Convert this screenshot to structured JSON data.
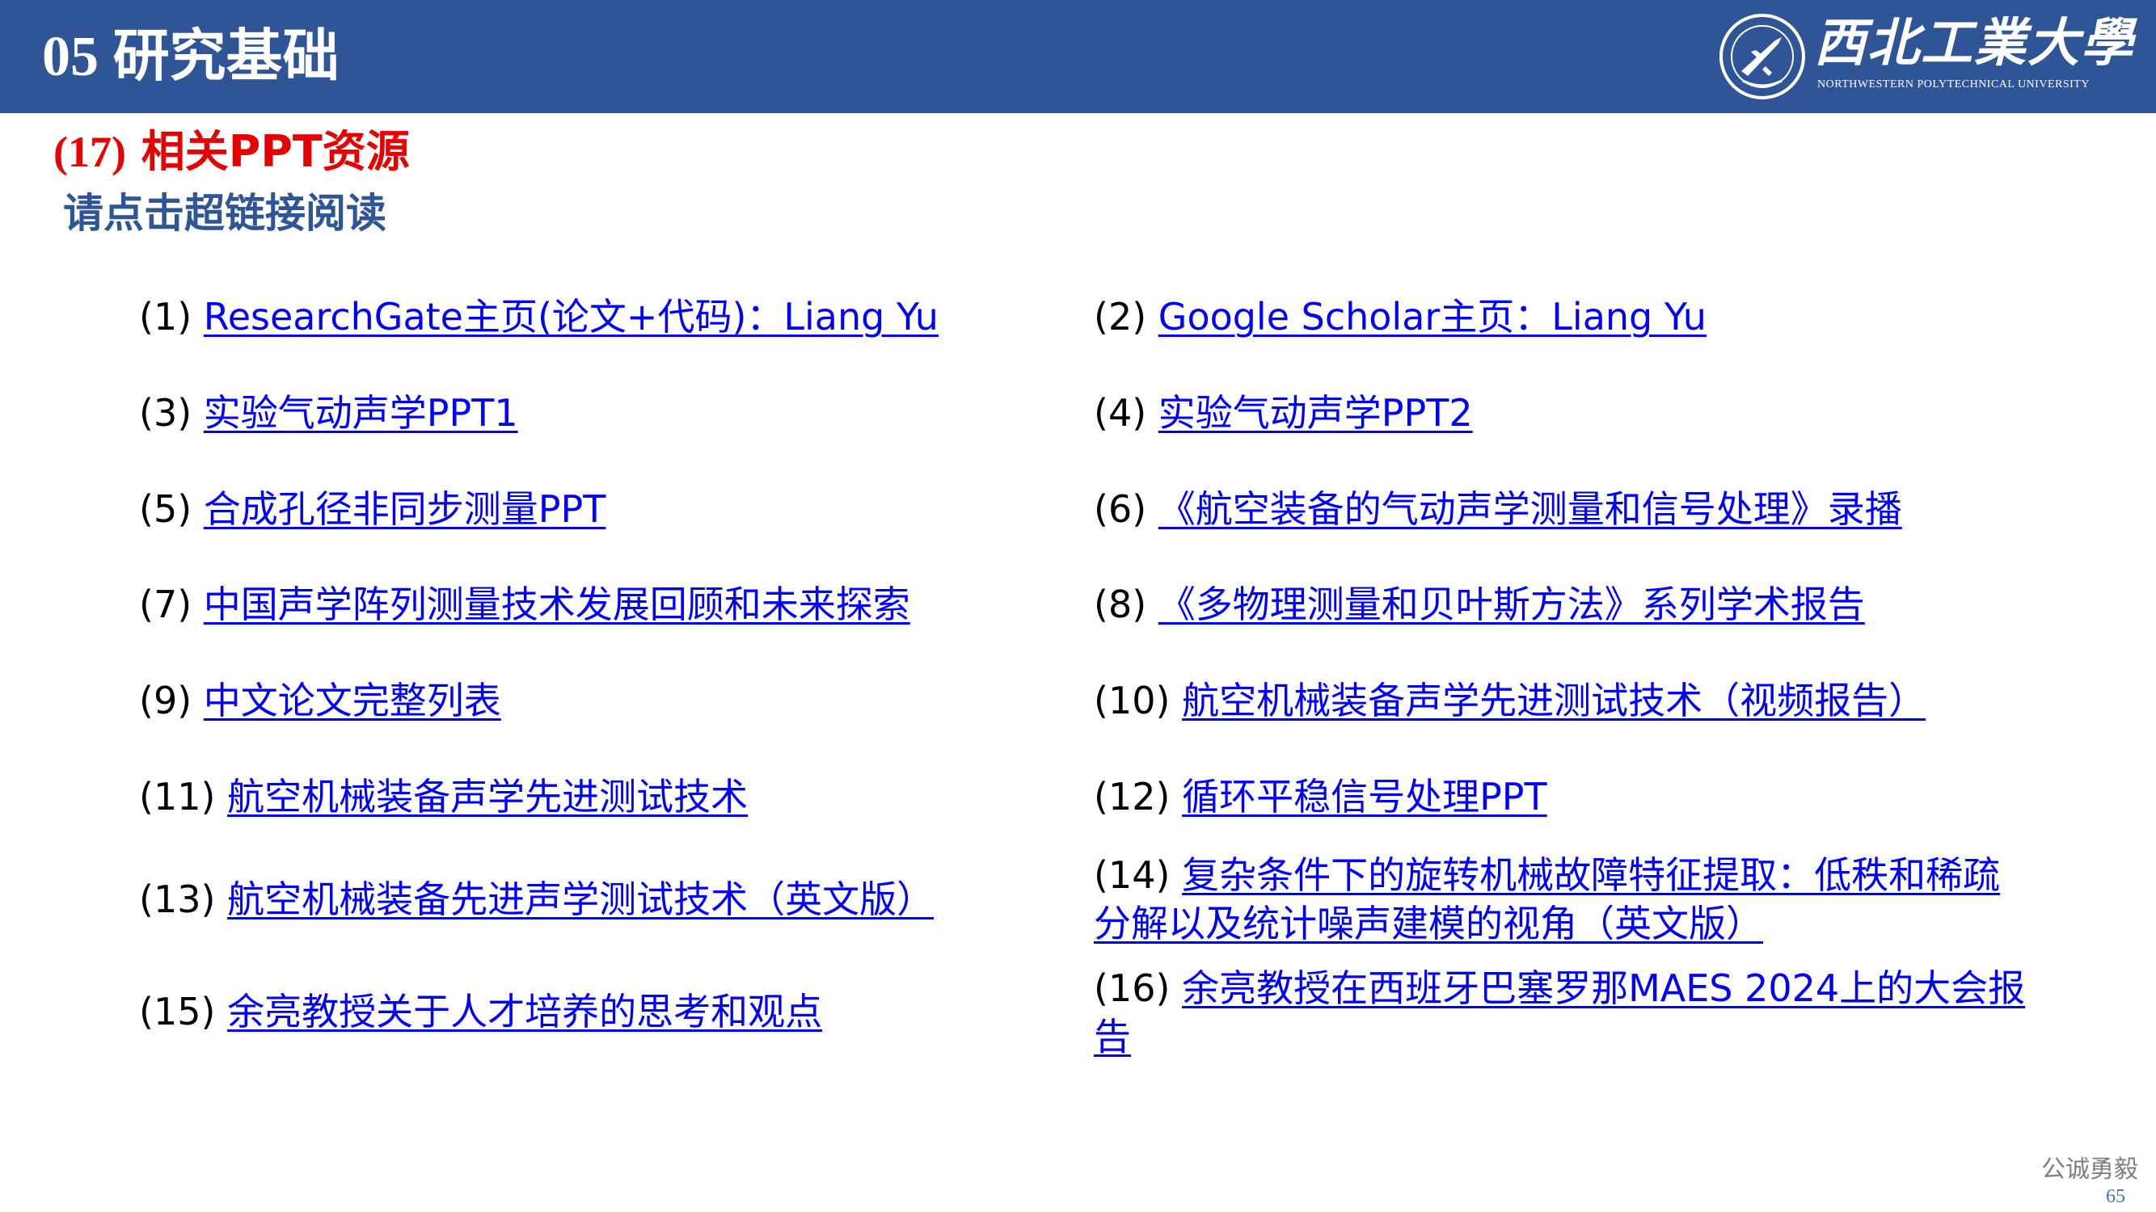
{
  "header": {
    "title": "05 研究基础",
    "logo_name": "西北工業大學",
    "logo_en": "NORTHWESTERN POLYTECHNICAL UNIVERSITY"
  },
  "section": {
    "number": "(17)",
    "title": "相关PPT资源",
    "instruction": "请点击超链接阅读"
  },
  "links": [
    {
      "num": "(1)",
      "text": "ResearchGate主页(论文+代码)：Liang Yu"
    },
    {
      "num": "(2)",
      "text": "Google Scholar主页：Liang Yu"
    },
    {
      "num": "(3)",
      "text": "实验气动声学PPT1"
    },
    {
      "num": "(4)",
      "text": "实验气动声学PPT2"
    },
    {
      "num": "(5)",
      "text": "合成孔径非同步测量PPT"
    },
    {
      "num": "(6)",
      "text": "《航空装备的气动声学测量和信号处理》录播"
    },
    {
      "num": "(7)",
      "text": "中国声学阵列测量技术发展回顾和未来探索"
    },
    {
      "num": "(8)",
      "text": "《多物理测量和贝叶斯方法》系列学术报告"
    },
    {
      "num": "(9)",
      "text": "中文论文完整列表"
    },
    {
      "num": "(10)",
      "text": "航空机械装备声学先进测试技术（视频报告）"
    },
    {
      "num": "(11)",
      "text": "航空机械装备声学先进测试技术"
    },
    {
      "num": "(12)",
      "text": "循环平稳信号处理PPT"
    },
    {
      "num": "(13)",
      "text": "航空机械装备先进声学测试技术（英文版）"
    },
    {
      "num": "(14)",
      "text": "复杂条件下的旋转机械故障特征提取：低秩和稀疏分解以及统计噪声建模的视角（英文版）"
    },
    {
      "num": "(15)",
      "text": "余亮教授关于人才培养的思考和观点"
    },
    {
      "num": "(16)",
      "text": "余亮教授在西班牙巴塞罗那MAES 2024上的大会报告"
    }
  ],
  "footer": {
    "motto": "公诚勇毅",
    "page_number": "65"
  },
  "colors": {
    "header_bg": "#2f5597",
    "section_title": "#e60000",
    "instruction": "#2f5597",
    "link": "#0000ff"
  },
  "icons": {
    "logo": "university-seal-icon"
  }
}
